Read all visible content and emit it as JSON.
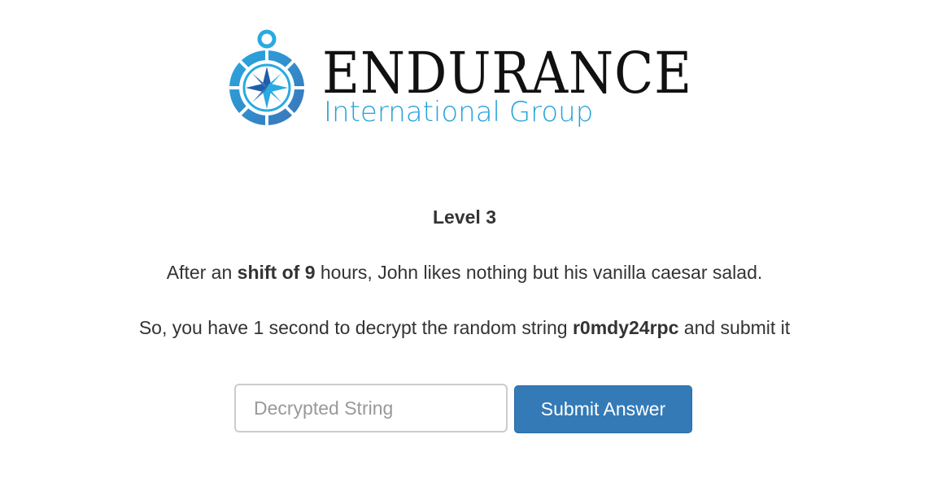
{
  "logo": {
    "wordmark": "ENDURANCE",
    "subtitle": "International Group",
    "colors": {
      "wordmark": "#111111",
      "subtitle": "#27a2d9",
      "compass_light": "#29aae1",
      "compass_dark": "#3a73b8"
    }
  },
  "challenge": {
    "title": "Level 3",
    "line1": {
      "prefix": "After an ",
      "bold": "shift of 9",
      "suffix": " hours, John likes nothing but his vanilla caesar salad."
    },
    "line2": {
      "prefix": "So, you have 1 second to decrypt the random string ",
      "bold": "r0mdy24rpc",
      "suffix": " and submit it"
    }
  },
  "form": {
    "input_placeholder": "Decrypted String",
    "input_value": "",
    "submit_label": "Submit Answer",
    "button_color": "#337ab7"
  }
}
